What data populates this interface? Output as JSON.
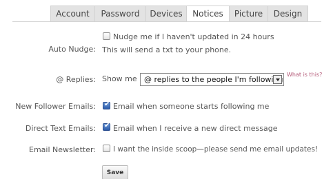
{
  "tabs": [
    {
      "label": "Account",
      "active": false
    },
    {
      "label": "Password",
      "active": false
    },
    {
      "label": "Devices",
      "active": false
    },
    {
      "label": "Notices",
      "active": true
    },
    {
      "label": "Picture",
      "active": false
    },
    {
      "label": "Design",
      "active": false
    }
  ],
  "auto_nudge": {
    "label": "Auto Nudge:",
    "checkbox_text": "Nudge me if I haven't updated in 24 hours",
    "checked": false,
    "note": "This will send a txt to your phone."
  },
  "replies": {
    "label": "@ Replies:",
    "prefix": "Show me",
    "selected_option": "@ replies to the people I'm following",
    "help_link": "What is this?"
  },
  "new_follower": {
    "label": "New Follower Emails:",
    "checkbox_text": "Email when someone starts following me",
    "checked": true
  },
  "direct_text": {
    "label": "Direct Text Emails:",
    "checkbox_text": "Email when I receive a new direct message",
    "checked": true
  },
  "newsletter": {
    "label": "Email Newsletter:",
    "checkbox_text": "I want the inside scoop—please send me email updates!",
    "checked": false
  },
  "save_label": "Save"
}
